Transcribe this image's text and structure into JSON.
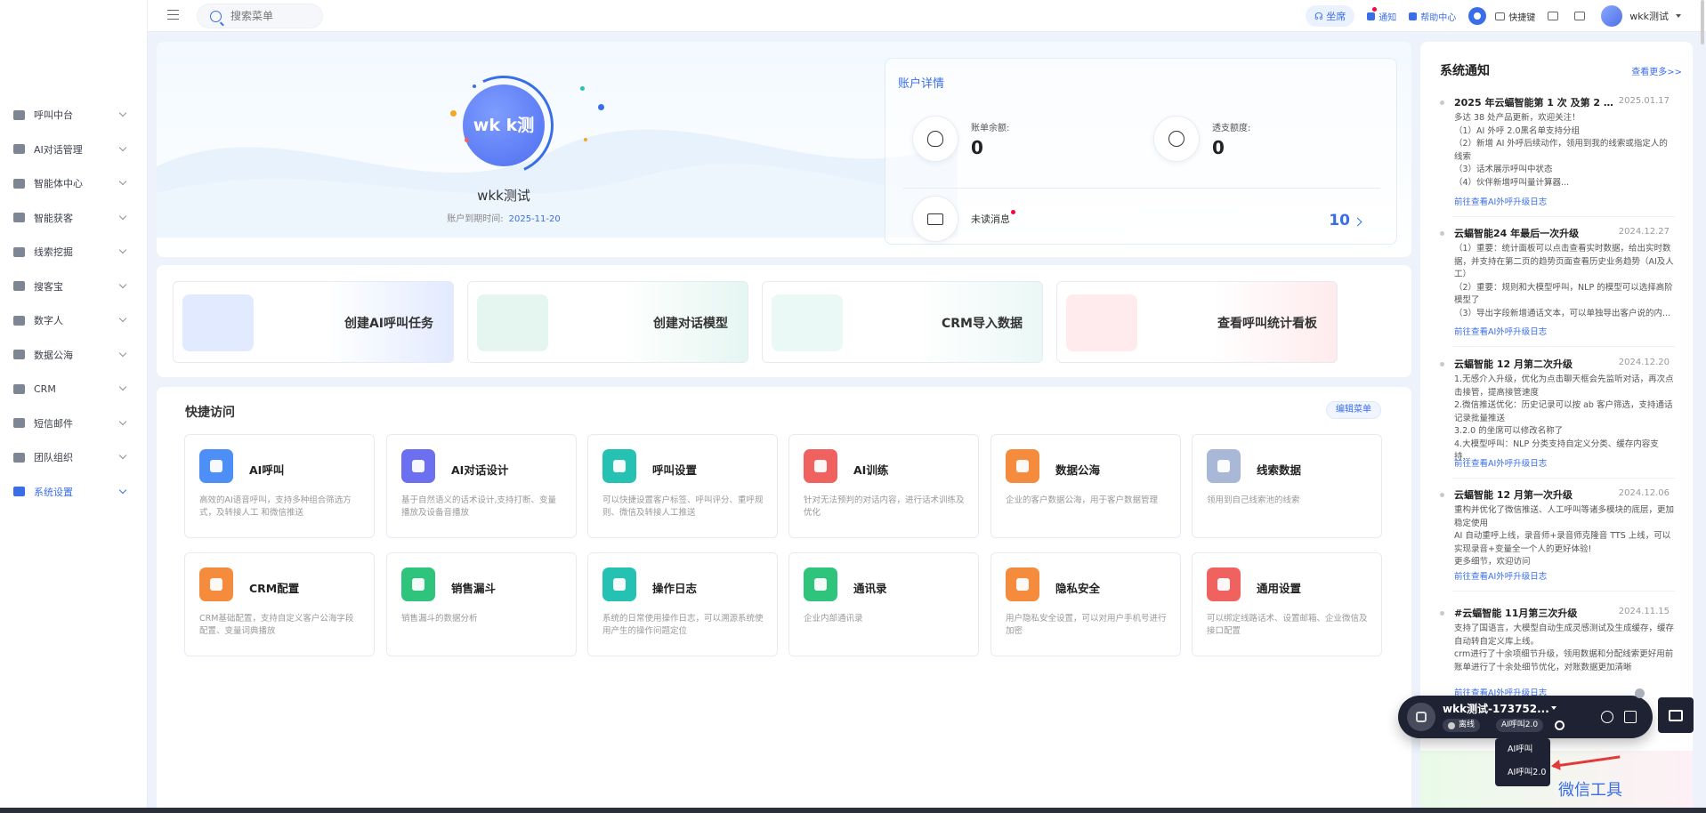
{
  "sidebar": {
    "items": [
      {
        "label": "呼叫中台",
        "icon": "monitor-icon",
        "active": false
      },
      {
        "label": "AI对话管理",
        "icon": "chat-icon",
        "active": false
      },
      {
        "label": "智能体中心",
        "icon": "agent-icon",
        "active": false
      },
      {
        "label": "智能获客",
        "icon": "target-icon",
        "active": false
      },
      {
        "label": "线索挖掘",
        "icon": "dig-icon",
        "active": false
      },
      {
        "label": "搜客宝",
        "icon": "search-customer-icon",
        "active": false
      },
      {
        "label": "数字人",
        "icon": "person-icon",
        "active": false
      },
      {
        "label": "数据公海",
        "icon": "data-sea-icon",
        "active": false
      },
      {
        "label": "CRM",
        "icon": "crm-icon",
        "active": false
      },
      {
        "label": "短信邮件",
        "icon": "sms-icon",
        "active": false
      },
      {
        "label": "团队组织",
        "icon": "team-icon",
        "active": false
      },
      {
        "label": "系统设置",
        "icon": "settings-grid-icon",
        "active": true
      }
    ]
  },
  "topbar": {
    "search_placeholder": "搜索菜单",
    "seat": "坐席",
    "notice": "通知",
    "help": "帮助中心",
    "shortcut": "快捷键",
    "user": "wkk测试"
  },
  "profile": {
    "avatar_text": "wk k测",
    "name": "wkk测试",
    "expire_label": "账户到期时间:",
    "expire_date": "2025-11-20"
  },
  "account": {
    "title": "账户详情",
    "balance_label": "账单余额:",
    "balance_value": "0",
    "overdraft_label": "透支额度:",
    "overdraft_value": "0",
    "unread_label": "未读消息",
    "unread_count": "10"
  },
  "actions": [
    {
      "title": "创建AI呼叫任务",
      "accent": "#c9d8ff"
    },
    {
      "title": "创建对话模型",
      "accent": "#cfeee6"
    },
    {
      "title": "CRM导入数据",
      "accent": "#d9f2ee"
    },
    {
      "title": "查看呼叫统计看板",
      "accent": "#ffd9de"
    }
  ],
  "quick": {
    "title": "快捷访问",
    "edit_label": "编辑菜单",
    "items": [
      {
        "name": "AI呼叫",
        "desc": "高效的AI语音呼叫，支持多种组合筛选方式，及转接人工 和微信推送",
        "color": "#4e8ef7"
      },
      {
        "name": "AI对话设计",
        "desc": "基于自然语义的话术设计,支持打断、变量播放及设备音播放",
        "color": "#6b6ff0"
      },
      {
        "name": "呼叫设置",
        "desc": "可以快捷设置客户标签、呼叫评分、重呼规则、微信及转接人工推送",
        "color": "#25c2b4"
      },
      {
        "name": "AI训练",
        "desc": "针对无法预判的对话内容，进行话术训练及优化",
        "color": "#f0625f"
      },
      {
        "name": "数据公海",
        "desc": "企业的客户数据公海，用于客户数据管理",
        "color": "#f58b3c"
      },
      {
        "name": "线索数据",
        "desc": "领用到自己线索池的线索",
        "color": "#a8b8d6"
      },
      {
        "name": "CRM配置",
        "desc": "CRM基础配置，支持自定义客户公海字段配置、变量词典播放",
        "color": "#f58b3c"
      },
      {
        "name": "销售漏斗",
        "desc": "销售漏斗的数据分析",
        "color": "#2fc47b"
      },
      {
        "name": "操作日志",
        "desc": "系统的日常使用操作日志，可以溯源系统使用产生的操作问题定位",
        "color": "#25c2b4"
      },
      {
        "name": "通讯录",
        "desc": "企业内部通讯录",
        "color": "#2fc47b"
      },
      {
        "name": "隐私安全",
        "desc": "用户隐私安全设置，可以对用户手机号进行加密",
        "color": "#f58b3c"
      },
      {
        "name": "通用设置",
        "desc": "可以绑定线路话术、设置邮箱、企业微信及接口配置",
        "color": "#f0625f"
      }
    ]
  },
  "notices": {
    "title": "系统通知",
    "more": "查看更多>>",
    "link_label": "前往查看AI外呼升级日志",
    "items": [
      {
        "title": "2025 年云蝠智能第 1 次 及第 2 次升级",
        "date": "2025.01.17",
        "body": [
          "多达 38 处产品更新，欢迎关注！",
          "（1）AI 外呼 2.0黑名单支持分组",
          "（2）新增 AI 外呼后续动作，领用到我的线索或指定人的线索",
          "（3）话术展示呼叫中状态",
          "（4）伙伴新增呼叫量计算器..."
        ]
      },
      {
        "title": "云蝠智能24 年最后一次升级",
        "date": "2024.12.27",
        "body": [
          "（1）重要：统计面板可以点击查看实时数据，给出实时数据，并支持在第二页的趋势页面查看历史业务趋势（AI及人工）",
          "（2）重要：规则和大模型呼叫，NLP 的模型可以选择高阶模型了",
          "（3）导出字段新增通话文本，可以单独导出客户说的内..."
        ]
      },
      {
        "title": "云蝠智能 12 月第二次升级",
        "date": "2024.12.20",
        "body": [
          "1.无感介入升级，优化为点击聊天框会先监听对话，再次点击接管，提高接管速度",
          "2.微信推送优化：历史记录可以按 ab 客户筛选，支持通话记录批量推送",
          "3.2.0 的坐席可以修改名称了",
          "4.大模型呼叫：NLP 分类支持自定义分类、缓存内容支持..."
        ]
      },
      {
        "title": "云蝠智能 12 月第一次升级",
        "date": "2024.12.06",
        "body": [
          "重构并优化了微信推送、人工呼叫等诸多模块的底层，更加稳定使用",
          "AI 自动重呼上线，录音师+录音师克隆音 TTS 上线，可以实现录音+变量全一个人的更好体验!",
          "更多细节，欢迎访问"
        ]
      },
      {
        "title": "#云蝠智能 11月第三次升级",
        "date": "2024.11.15",
        "body": [
          "支持了国语言，大模型自动生成灵感测试及生成缓存，缓存自动转自定义库上线。",
          "crm进行了十余项细节升级，领用数据和分配线索更好用前账单进行了十余处细节优化，对账数据更加清晰"
        ]
      }
    ]
  },
  "wechat_tool": "微信工具",
  "phone": {
    "name": "wkk测试-173752...",
    "status": "离线",
    "mode": "AI呼叫2.0",
    "options": [
      "AI呼叫",
      "AI呼叫2.0"
    ]
  }
}
